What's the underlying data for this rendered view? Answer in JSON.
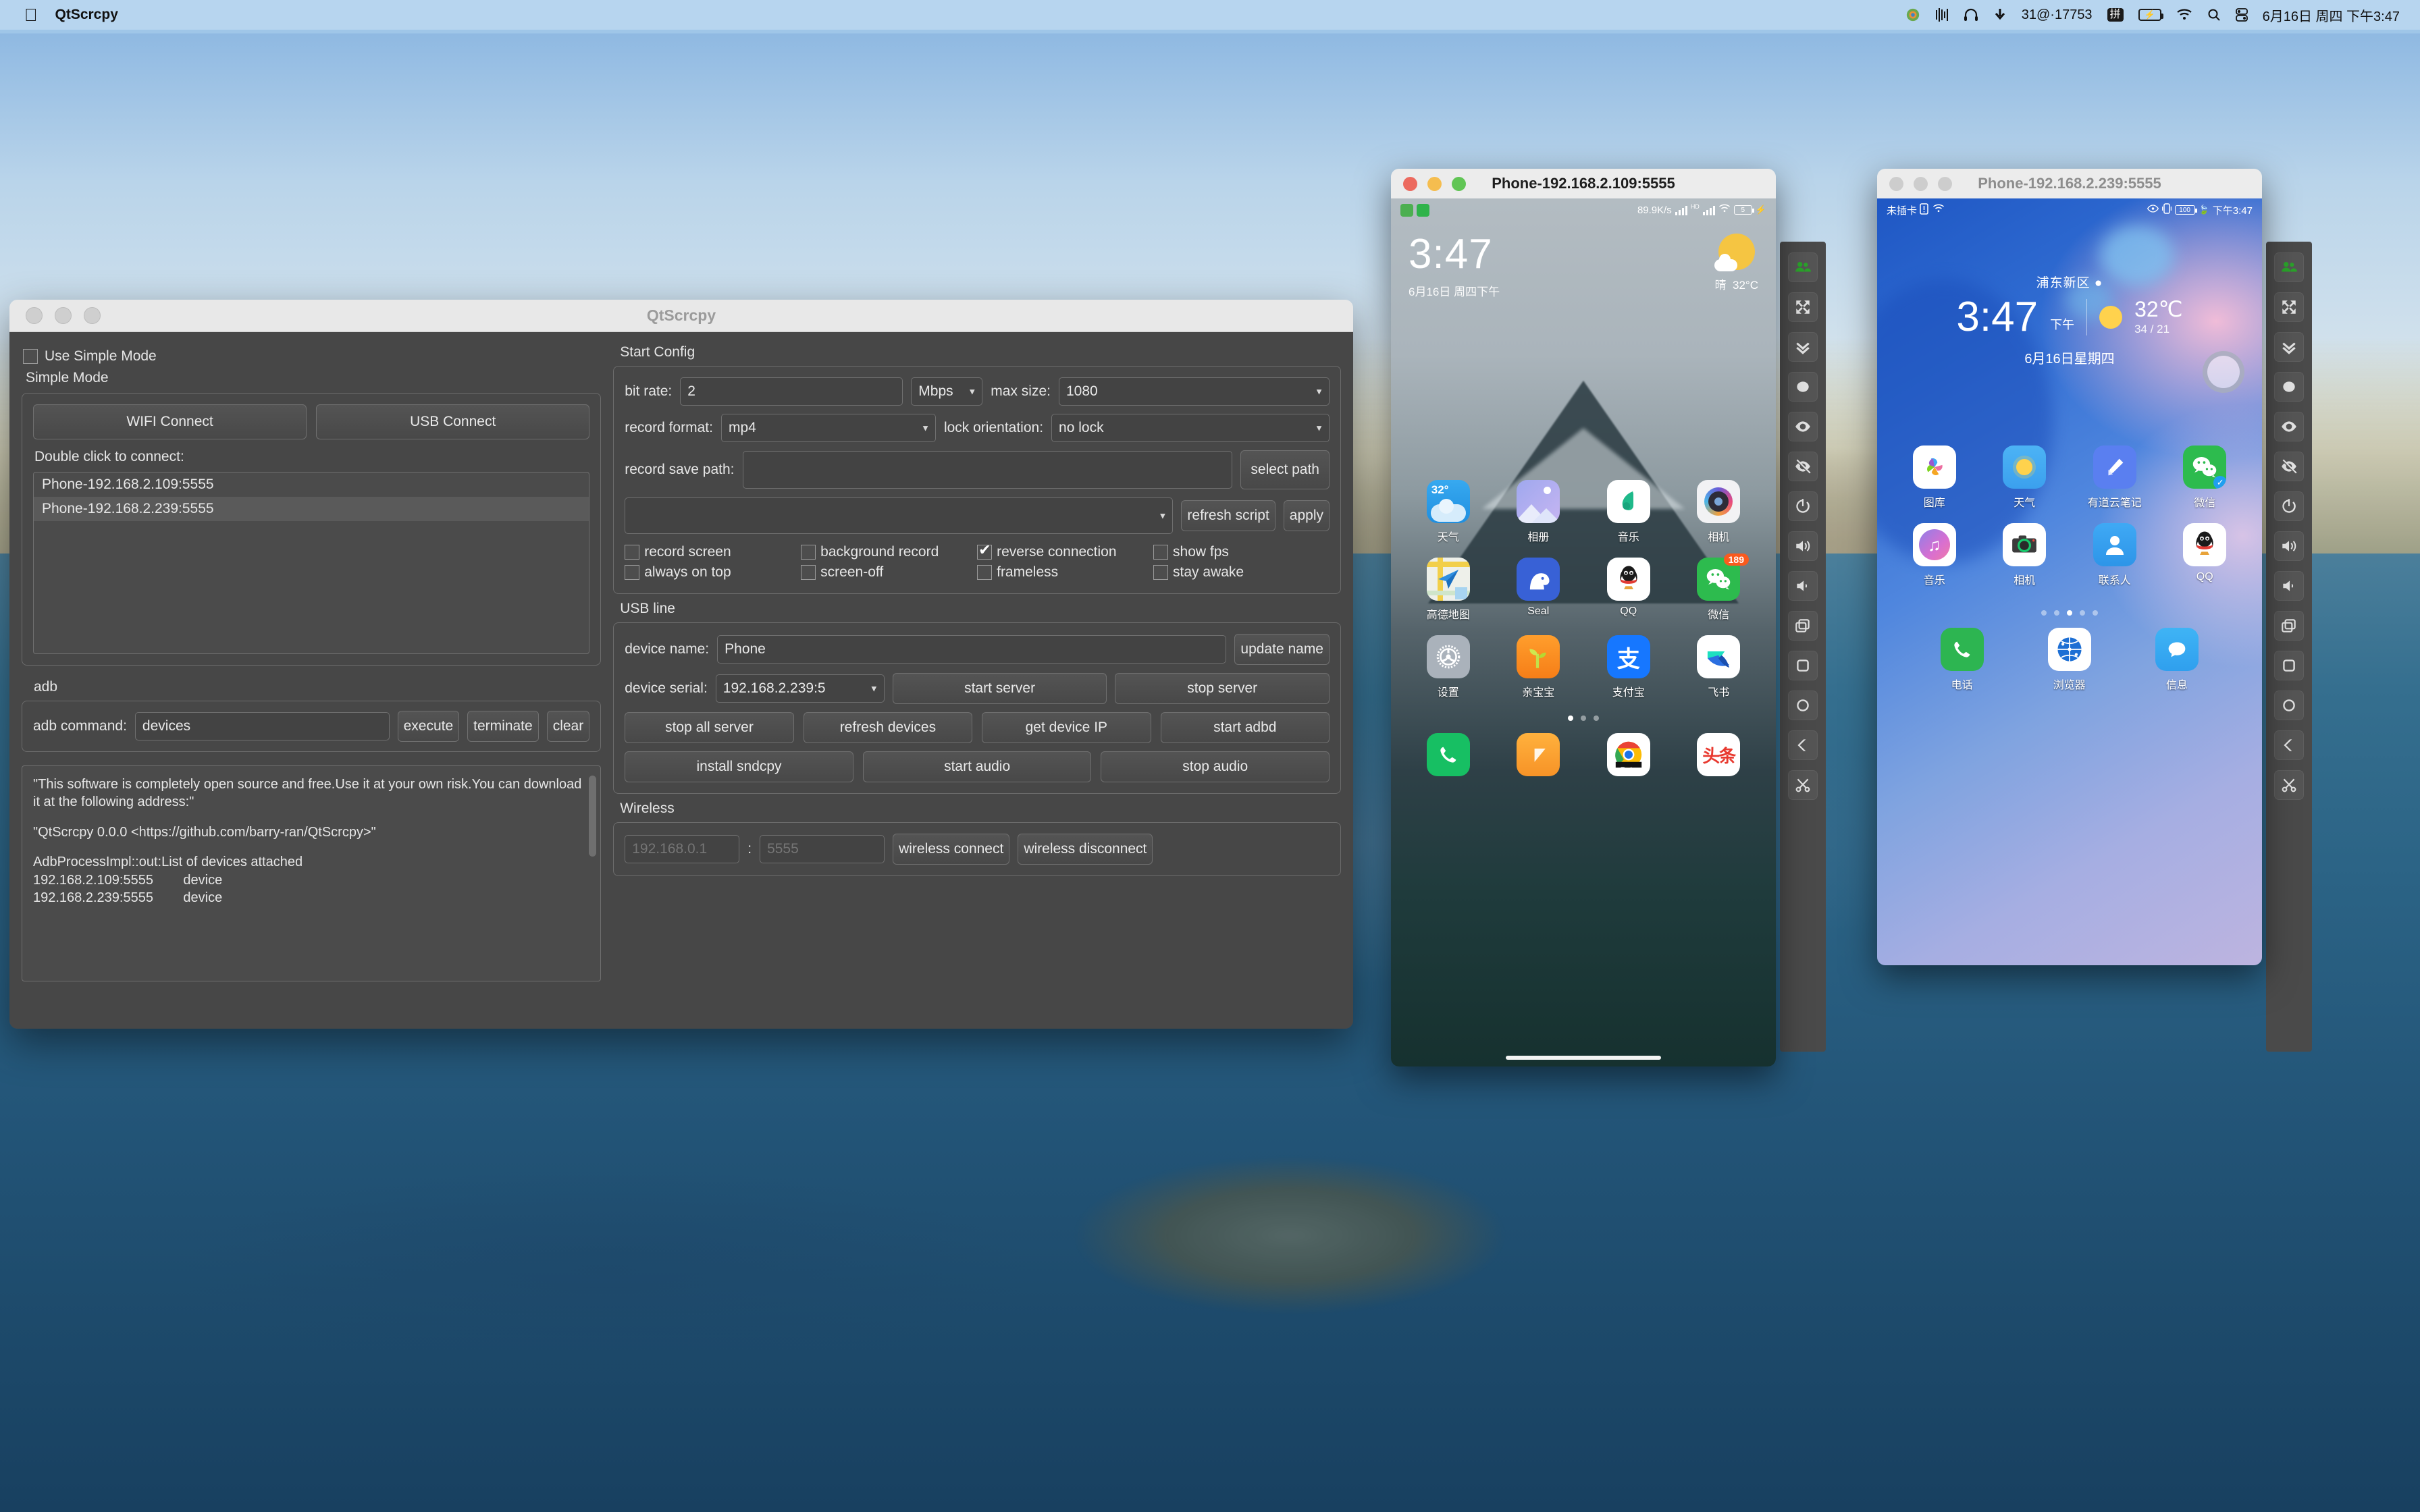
{
  "menubar": {
    "apple_icon": "apple-logo",
    "app_name": "QtScrcpy",
    "status_items": [
      {
        "name": "colorsync-icon",
        "glyph": "◉"
      },
      {
        "name": "audio-meter-icon",
        "glyph": "∭"
      },
      {
        "name": "headphone-icon",
        "glyph": "∩"
      },
      {
        "name": "download-icon",
        "glyph": "⬇"
      }
    ],
    "network_speed": "31@·17753",
    "input_method": "拼",
    "battery_charging": "⚡",
    "wifi_icon": "wifi-icon",
    "search_icon": "search-icon",
    "controlcenter_icon": "control-center-icon",
    "clock": "6月16日 周四 下午3:47"
  },
  "qtscrcpy": {
    "window_title": "QtScrcpy",
    "simple_mode": {
      "checkbox_label": "Use Simple Mode",
      "checked": false,
      "group_title": "Simple Mode",
      "wifi_connect": "WIFI Connect",
      "usb_connect": "USB Connect",
      "double_click_hint": "Double click to connect:",
      "devices": [
        {
          "label": "Phone-192.168.2.109:5555",
          "selected": false
        },
        {
          "label": "Phone-192.168.2.239:5555",
          "selected": true
        }
      ]
    },
    "adb": {
      "group_title": "adb",
      "command_label": "adb command:",
      "command_value": "devices",
      "execute": "execute",
      "terminate": "terminate",
      "clear": "clear",
      "log_lines": [
        "\"This software is completely open source and free.Use it at your own risk.You can download it at the following address:\"",
        "\"QtScrcpy 0.0.0 <https://github.com/barry-ran/QtScrcpy>\"",
        "AdbProcessImpl::out:List of devices attached",
        "192.168.2.109:5555        device",
        "192.168.2.239:5555        device"
      ]
    },
    "start_config": {
      "group_title": "Start Config",
      "bit_rate_label": "bit rate:",
      "bit_rate_value": "2",
      "bit_rate_unit": "Mbps",
      "max_size_label": "max size:",
      "max_size_value": "1080",
      "record_format_label": "record format:",
      "record_format_value": "mp4",
      "lock_orientation_label": "lock orientation:",
      "lock_orientation_value": "no lock",
      "record_save_path_label": "record save path:",
      "record_save_path_value": "",
      "select_path": "select path",
      "script_value": "",
      "refresh_script": "refresh script",
      "apply": "apply",
      "checkboxes": [
        {
          "label": "record screen",
          "checked": false
        },
        {
          "label": "background record",
          "checked": false
        },
        {
          "label": "reverse connection",
          "checked": true
        },
        {
          "label": "show fps",
          "checked": false
        },
        {
          "label": "always on top",
          "checked": false
        },
        {
          "label": "screen-off",
          "checked": false
        },
        {
          "label": "frameless",
          "checked": false
        },
        {
          "label": "stay awake",
          "checked": false
        }
      ]
    },
    "usb_line": {
      "group_title": "USB line",
      "device_name_label": "device name:",
      "device_name_value": "Phone",
      "update_name": "update name",
      "device_serial_label": "device serial:",
      "device_serial_value": "192.168.2.239:5",
      "start_server": "start server",
      "stop_server": "stop server",
      "stop_all_server": "stop all server",
      "refresh_devices": "refresh devices",
      "get_device_ip": "get device IP",
      "start_adbd": "start adbd",
      "install_sndcpy": "install sndcpy",
      "start_audio": "start audio",
      "stop_audio": "stop audio"
    },
    "wireless": {
      "group_title": "Wireless",
      "ip_placeholder": "192.168.0.1",
      "colon": ":",
      "port_placeholder": "5555",
      "connect": "wireless connect",
      "disconnect": "wireless disconnect"
    }
  },
  "phone1": {
    "title": "Phone-192.168.2.109:5555",
    "active": true,
    "status": {
      "net_speed": "89.9K/s",
      "hd_label": "HD",
      "battery_level": "5"
    },
    "clock": {
      "time": "3:47",
      "date": "6月16日 周四下午",
      "weather_text": "晴",
      "temp": "32°C"
    },
    "apps": [
      {
        "label": "天气",
        "icon": "weather-icon",
        "badge": null
      },
      {
        "label": "相册",
        "icon": "gallery-icon",
        "badge": null
      },
      {
        "label": "音乐",
        "icon": "music-icon",
        "badge": null
      },
      {
        "label": "相机",
        "icon": "camera-icon",
        "badge": null
      },
      {
        "label": "高德地图",
        "icon": "amap-icon",
        "badge": null
      },
      {
        "label": "Seal",
        "icon": "seal-icon",
        "badge": null
      },
      {
        "label": "QQ",
        "icon": "qq-icon",
        "badge": null
      },
      {
        "label": "微信",
        "icon": "wechat-icon",
        "badge": "189"
      },
      {
        "label": "设置",
        "icon": "settings-icon",
        "badge": null
      },
      {
        "label": "亲宝宝",
        "icon": "qinbaobao-icon",
        "badge": null
      },
      {
        "label": "支付宝",
        "icon": "alipay-icon",
        "badge": null
      },
      {
        "label": "飞书",
        "icon": "feishu-icon",
        "badge": null
      }
    ],
    "page_dots": {
      "count": 3,
      "active": 0
    },
    "dock": [
      {
        "label": "",
        "icon": "phone-icon"
      },
      {
        "label": "",
        "icon": "messages-icon"
      },
      {
        "label": "",
        "icon": "chrome-beta-icon"
      },
      {
        "label": "",
        "icon": "toutiao-icon"
      }
    ],
    "weather_badge": "32°"
  },
  "phone2": {
    "title": "Phone-192.168.2.239:5555",
    "active": false,
    "status": {
      "sim": "未插卡",
      "battery_level": "100",
      "time": "下午3:47"
    },
    "clock": {
      "location": "浦东新区",
      "time": "3:47",
      "ampm": "下午",
      "temp": "32℃",
      "temp_range": "34 / 21",
      "date": "6月16日星期四"
    },
    "apps": [
      {
        "label": "图库",
        "icon": "gallery-icon",
        "check": false
      },
      {
        "label": "天气",
        "icon": "weather-icon",
        "check": false
      },
      {
        "label": "有道云笔记",
        "icon": "youdao-note-icon",
        "check": false
      },
      {
        "label": "微信",
        "icon": "wechat-icon",
        "check": true
      },
      {
        "label": "音乐",
        "icon": "music-icon",
        "check": false
      },
      {
        "label": "相机",
        "icon": "camera-icon",
        "check": false
      },
      {
        "label": "联系人",
        "icon": "contacts-icon",
        "check": false
      },
      {
        "label": "QQ",
        "icon": "qq-icon",
        "check": false
      }
    ],
    "page_dots": {
      "count": 5,
      "active": 2
    },
    "dock": [
      {
        "label": "电话",
        "icon": "phone-icon"
      },
      {
        "label": "浏览器",
        "icon": "browser-icon"
      },
      {
        "label": "信息",
        "icon": "messages-icon"
      }
    ]
  },
  "toolbar": {
    "buttons": [
      {
        "name": "group-control-icon",
        "title": "group control"
      },
      {
        "name": "fullscreen-icon",
        "title": "full screen"
      },
      {
        "name": "expand-notification-icon",
        "title": "expand notification"
      },
      {
        "name": "touch-dot-icon",
        "title": "touch switch"
      },
      {
        "name": "eye-show-icon",
        "title": "show touches"
      },
      {
        "name": "eye-hide-icon",
        "title": "hide touches"
      },
      {
        "name": "power-icon",
        "title": "power"
      },
      {
        "name": "volume-up-icon",
        "title": "volume up"
      },
      {
        "name": "volume-down-icon",
        "title": "volume down"
      },
      {
        "name": "app-switch-icon",
        "title": "app switch"
      },
      {
        "name": "menu-square-icon",
        "title": "menu"
      },
      {
        "name": "home-circle-icon",
        "title": "home"
      },
      {
        "name": "back-arrow-icon",
        "title": "back"
      },
      {
        "name": "screenshot-scissors-icon",
        "title": "screenshot"
      }
    ]
  }
}
